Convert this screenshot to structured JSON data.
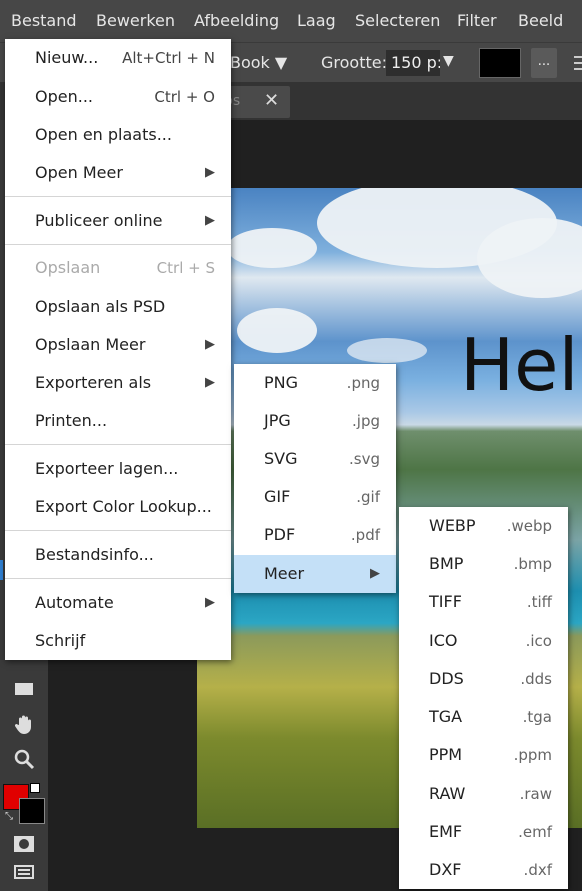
{
  "menubar": [
    "Bestand",
    "Bewerken",
    "Afbeelding",
    "Laag",
    "Selecteren",
    "Filter",
    "Beeld"
  ],
  "toolbar": {
    "font": "Book ▼",
    "size_label": "Grootte:",
    "size_value": "150 p:",
    "size_arrow": "▼",
    "more": "..."
  },
  "tab": {
    "label": "ps",
    "close": "✕"
  },
  "canvas_text": "Hel",
  "file_menu": [
    {
      "label": "Nieuw...",
      "shortcut": "Alt+Ctrl + N"
    },
    {
      "label": "Open...",
      "shortcut": "Ctrl + O"
    },
    {
      "label": "Open en plaats...",
      "shortcut": ""
    },
    {
      "label": "Open Meer",
      "arrow": "▶"
    },
    {
      "label": "Publiceer online",
      "arrow": "▶"
    },
    {
      "label": "Opslaan",
      "shortcut": "Ctrl + S",
      "disabled": true
    },
    {
      "label": "Opslaan als PSD",
      "shortcut": ""
    },
    {
      "label": "Opslaan Meer",
      "arrow": "▶"
    },
    {
      "label": "Exporteren als",
      "arrow": "▶"
    },
    {
      "label": "Printen...",
      "shortcut": ""
    },
    {
      "label": "Exporteer lagen...",
      "shortcut": ""
    },
    {
      "label": "Export Color Lookup...",
      "shortcut": ""
    },
    {
      "label": "Bestandsinfo...",
      "shortcut": ""
    },
    {
      "label": "Automate",
      "arrow": "▶"
    },
    {
      "label": "Schrijf",
      "shortcut": ""
    }
  ],
  "export_menu": [
    {
      "label": "PNG",
      "ext": ".png"
    },
    {
      "label": "JPG",
      "ext": ".jpg"
    },
    {
      "label": "SVG",
      "ext": ".svg"
    },
    {
      "label": "GIF",
      "ext": ".gif"
    },
    {
      "label": "PDF",
      "ext": ".pdf"
    },
    {
      "label": "Meer",
      "ext": "▶",
      "active": true
    }
  ],
  "more_menu": [
    {
      "label": "WEBP",
      "ext": ".webp"
    },
    {
      "label": "BMP",
      "ext": ".bmp"
    },
    {
      "label": "TIFF",
      "ext": ".tiff"
    },
    {
      "label": "ICO",
      "ext": ".ico"
    },
    {
      "label": "DDS",
      "ext": ".dds"
    },
    {
      "label": "TGA",
      "ext": ".tga"
    },
    {
      "label": "PPM",
      "ext": ".ppm"
    },
    {
      "label": "RAW",
      "ext": ".raw"
    },
    {
      "label": "EMF",
      "ext": ".emf"
    },
    {
      "label": "DXF",
      "ext": ".dxf"
    }
  ],
  "colors": {
    "foreground": "#e10000",
    "background": "#000000",
    "menu_highlight": "#c4e0f7"
  }
}
